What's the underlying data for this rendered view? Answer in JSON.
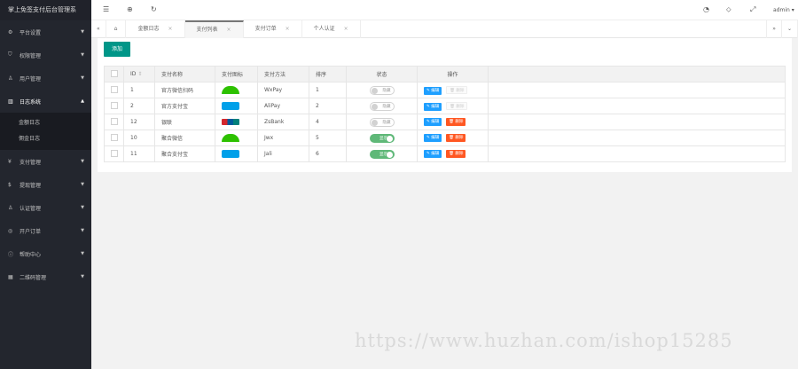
{
  "app_title": "掌上免签支付后台管理系",
  "sidebar": {
    "items": [
      {
        "icon": "gear-icon",
        "label": "平台设置"
      },
      {
        "icon": "shield-icon",
        "label": "权限管理"
      },
      {
        "icon": "user-icon",
        "label": "用户管理"
      },
      {
        "icon": "book-icon",
        "label": "日志系统",
        "expanded": true,
        "children": [
          "金额日志",
          "佣金日志"
        ]
      },
      {
        "icon": "yen-icon",
        "label": "支付管理"
      },
      {
        "icon": "dollar-icon",
        "label": "提现管理"
      },
      {
        "icon": "user-icon",
        "label": "认证管理"
      },
      {
        "icon": "compass-icon",
        "label": "开户订单"
      },
      {
        "icon": "info-icon",
        "label": "帮助中心"
      },
      {
        "icon": "qrcode-icon",
        "label": "二维码管理"
      }
    ]
  },
  "header": {
    "user": "admin"
  },
  "tabs": [
    {
      "label": "金额日志"
    },
    {
      "label": "支付列表",
      "active": true
    },
    {
      "label": "支付订单"
    },
    {
      "label": "个人认证"
    }
  ],
  "toolbar": {
    "add_label": "添加"
  },
  "table": {
    "headers": [
      "ID",
      "支付名称",
      "支付图标",
      "支付方法",
      "排序",
      "状态",
      "操作"
    ],
    "rows": [
      {
        "id": "1",
        "name": "官方微信扫码",
        "icon": "wechat",
        "method": "WxPay",
        "sort": "1",
        "status": "隐藏",
        "on": false,
        "deletable": false
      },
      {
        "id": "2",
        "name": "官方支付宝",
        "icon": "alipay",
        "method": "AliPay",
        "sort": "2",
        "status": "隐藏",
        "on": false,
        "deletable": false
      },
      {
        "id": "12",
        "name": "银联",
        "icon": "unionpay",
        "method": "ZsBank",
        "sort": "4",
        "status": "隐藏",
        "on": false,
        "deletable": true
      },
      {
        "id": "10",
        "name": "聚合微信",
        "icon": "wechat",
        "method": "Jwx",
        "sort": "5",
        "status": "显示",
        "on": true,
        "deletable": true
      },
      {
        "id": "11",
        "name": "聚合支付宝",
        "icon": "alipay",
        "method": "Jali",
        "sort": "6",
        "status": "显示",
        "on": true,
        "deletable": true
      }
    ],
    "edit_label": "编辑",
    "delete_label": "删除"
  },
  "watermark": "https://www.huzhan.com/ishop15285",
  "colors": {
    "wechat": "#2dc100",
    "alipay": "#00a0e9",
    "unionpay": "#d4272e"
  }
}
